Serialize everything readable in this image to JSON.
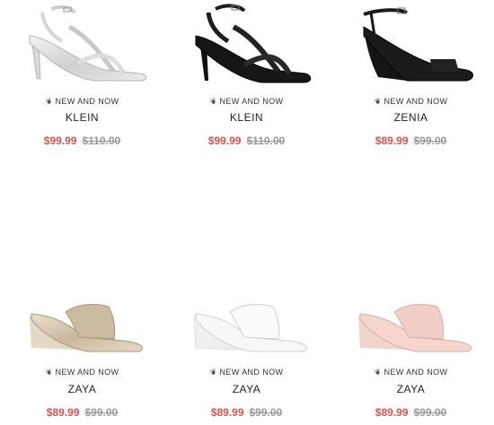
{
  "products": [
    {
      "tag": "NEW AND NOW",
      "name": "KLEIN",
      "sale_price": "$99.99",
      "original_price": "$110.00",
      "image": "silver-strappy-heel-sandal"
    },
    {
      "tag": "NEW AND NOW",
      "name": "KLEIN",
      "sale_price": "$99.99",
      "original_price": "$110.00",
      "image": "black-strappy-heel-sandal"
    },
    {
      "tag": "NEW AND NOW",
      "name": "ZENIA",
      "sale_price": "$89.99",
      "original_price": "$99.00",
      "image": "black-wedge-ankle-strap-sandal"
    },
    {
      "tag": "NEW AND NOW",
      "name": "ZAYA",
      "sale_price": "$89.99",
      "original_price": "$99.00",
      "image": "gold-wedge-mule"
    },
    {
      "tag": "NEW AND NOW",
      "name": "ZAYA",
      "sale_price": "$89.99",
      "original_price": "$99.00",
      "image": "white-wedge-mule"
    },
    {
      "tag": "NEW AND NOW",
      "name": "ZAYA",
      "sale_price": "$89.99",
      "original_price": "$99.00",
      "image": "blush-wedge-mule"
    }
  ],
  "colors": {
    "sale": "#d9534f",
    "original": "#999999",
    "text": "#222222"
  }
}
